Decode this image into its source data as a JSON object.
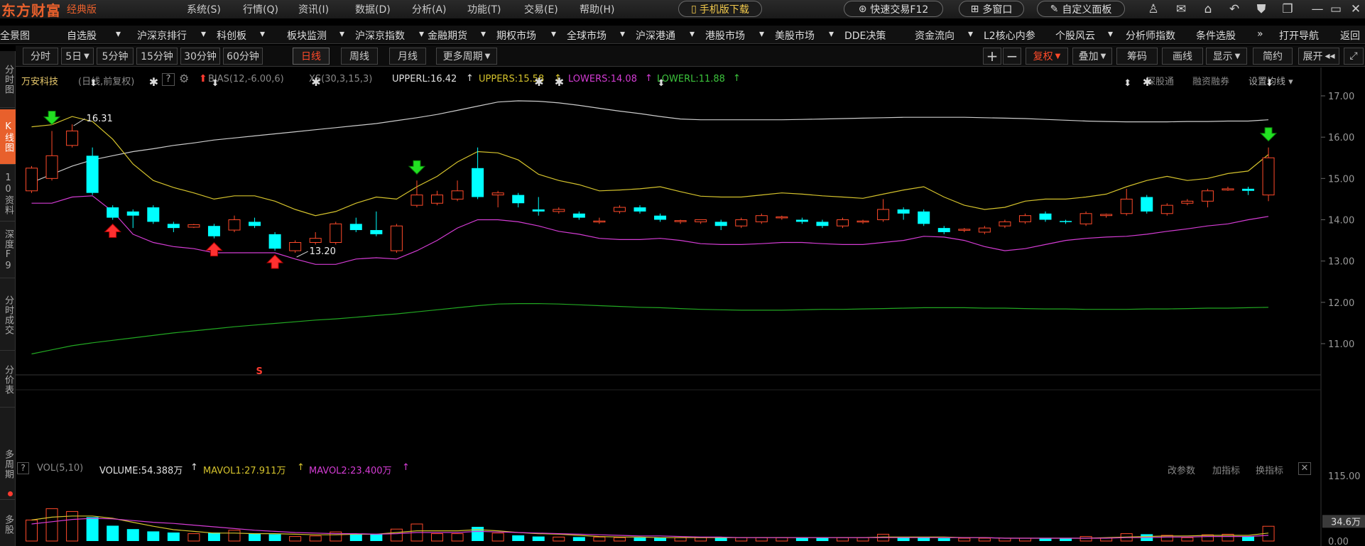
{
  "app": {
    "brand": "东方财富",
    "edition": "经典版"
  },
  "menu": [
    "系统(S)",
    "行情(Q)",
    "资讯(I)",
    "数据(D)",
    "分析(A)",
    "功能(T)",
    "交易(E)",
    "帮助(H)"
  ],
  "toolbar": {
    "mobile_download": "手机版下载",
    "fast_trade": "快速交易F12",
    "multi_window": "多窗口",
    "custom_panel": "自定义面板"
  },
  "nav": [
    "全景图",
    "自选股",
    "沪深京排行",
    "科创板",
    "板块监测",
    "沪深京指数",
    "金融期货",
    "期权市场",
    "全球市场",
    "沪深港通",
    "港股市场",
    "美股市场",
    "DDE决策",
    "资金流向",
    "L2核心内参",
    "个股风云",
    "分析师指数",
    "条件选股",
    "打开导航",
    "返回"
  ],
  "left_tabs": [
    "分时图",
    "K线图",
    "10资料",
    "深度F9",
    "分时成交",
    "分价表",
    "多周期",
    "多股"
  ],
  "periods": [
    "分时",
    "5日",
    "5分钟",
    "15分钟",
    "30分钟",
    "60分钟",
    "日线",
    "周线",
    "月线",
    "更多周期"
  ],
  "active_period": "日线",
  "right_tools": {
    "fuquan": "复权",
    "diejia": "叠加",
    "chouma": "筹码",
    "huaxian": "画线",
    "xianshi": "显示",
    "jianjie": "简约",
    "zhankai": "展开"
  },
  "info_bar": {
    "stock_name": "万安科技",
    "mode": "(日线,前复权)",
    "help": "?",
    "bias": "BIAS(12,-6.00,6)",
    "xs": "XS(30,3,15,3)",
    "upperl": "UPPERL:16.42",
    "uppers": "UPPERS:15.58",
    "lowers": "LOWERS:14.08",
    "lowerl": "LOWERL:11.88",
    "shengutong": "深股通",
    "rongzi": "融资融券",
    "set_ma": "设置均线"
  },
  "vol_bar": {
    "help": "?",
    "name": "VOL(5,10)",
    "volume": "VOLUME:54.388万",
    "mavol1": "MAVOL1:27.911万",
    "mavol2": "MAVOL2:23.400万",
    "gaicanshu": "改参数",
    "jiazhibiao": "加指标",
    "huanzhibiao": "换指标"
  },
  "colors": {
    "up": "#ff4a2a",
    "down": "#00ffff",
    "upperl": "#cccccc",
    "uppers": "#d4c22c",
    "lowers": "#d43cd4",
    "lowerl": "#22a822",
    "accent": "#e8602c"
  },
  "chart_data": {
    "type": "candlestick",
    "price_axis": {
      "ticks": [
        "17.00",
        "16.00",
        "15.00",
        "14.00",
        "13.00",
        "12.00",
        "11.00"
      ],
      "min": 10.5,
      "max": 17.2
    },
    "vol_axis": {
      "ticks": [
        "115.00",
        "34.6万",
        "0.00"
      ],
      "max": 115
    },
    "annotations": {
      "high": "16.31",
      "low": "13.20",
      "s_marker": "S"
    },
    "candles": [
      [
        14.7,
        15.25,
        14.65,
        15.3
      ],
      [
        15.0,
        15.55,
        14.95,
        16.15
      ],
      [
        15.8,
        16.15,
        15.75,
        16.31
      ],
      [
        15.55,
        14.65,
        14.6,
        15.75
      ],
      [
        14.3,
        14.05,
        14.0,
        14.35
      ],
      [
        14.2,
        14.1,
        13.8,
        14.25
      ],
      [
        14.3,
        13.95,
        13.9,
        14.35
      ],
      [
        13.9,
        13.8,
        13.7,
        13.95
      ],
      [
        13.82,
        13.88,
        13.8,
        13.9
      ],
      [
        13.85,
        13.6,
        13.55,
        13.9
      ],
      [
        13.75,
        14.0,
        13.7,
        14.1
      ],
      [
        13.95,
        13.85,
        13.8,
        14.05
      ],
      [
        13.65,
        13.3,
        13.25,
        13.7
      ],
      [
        13.25,
        13.45,
        13.2,
        13.5
      ],
      [
        13.45,
        13.55,
        13.4,
        13.7
      ],
      [
        13.45,
        13.9,
        13.4,
        13.95
      ],
      [
        13.9,
        13.75,
        13.7,
        14.05
      ],
      [
        13.75,
        13.65,
        13.6,
        14.2
      ],
      [
        13.25,
        13.85,
        13.2,
        13.9
      ],
      [
        14.35,
        14.6,
        14.3,
        14.95
      ],
      [
        14.4,
        14.6,
        14.35,
        14.7
      ],
      [
        14.5,
        14.7,
        14.45,
        14.95
      ],
      [
        15.25,
        14.55,
        14.5,
        15.75
      ],
      [
        14.6,
        14.65,
        14.3,
        14.7
      ],
      [
        14.6,
        14.4,
        14.3,
        14.65
      ],
      [
        14.25,
        14.2,
        14.1,
        14.55
      ],
      [
        14.2,
        14.25,
        14.15,
        14.3
      ],
      [
        14.15,
        14.05,
        14.0,
        14.2
      ],
      [
        13.95,
        13.97,
        13.9,
        14.05
      ],
      [
        14.2,
        14.3,
        14.15,
        14.35
      ],
      [
        14.3,
        14.2,
        14.15,
        14.35
      ],
      [
        14.1,
        14.0,
        13.95,
        14.15
      ],
      [
        13.97,
        13.98,
        13.9,
        14.0
      ],
      [
        13.95,
        14.0,
        13.9,
        14.0
      ],
      [
        13.95,
        13.85,
        13.75,
        14.0
      ],
      [
        13.85,
        14.0,
        13.8,
        14.05
      ],
      [
        13.95,
        14.1,
        13.9,
        14.15
      ],
      [
        14.05,
        14.07,
        14.0,
        14.1
      ],
      [
        14.0,
        13.95,
        13.9,
        14.05
      ],
      [
        13.95,
        13.85,
        13.8,
        14.0
      ],
      [
        13.85,
        14.0,
        13.8,
        14.05
      ],
      [
        13.95,
        13.97,
        13.9,
        14.0
      ],
      [
        14.0,
        14.25,
        13.95,
        14.5
      ],
      [
        14.25,
        14.15,
        14.0,
        14.3
      ],
      [
        14.2,
        13.9,
        13.85,
        14.25
      ],
      [
        13.8,
        13.7,
        13.65,
        13.85
      ],
      [
        13.75,
        13.77,
        13.7,
        13.8
      ],
      [
        13.7,
        13.8,
        13.65,
        13.85
      ],
      [
        13.85,
        13.95,
        13.8,
        14.0
      ],
      [
        13.95,
        14.1,
        13.9,
        14.15
      ],
      [
        14.15,
        14.0,
        13.95,
        14.2
      ],
      [
        13.97,
        13.95,
        13.9,
        14.0
      ],
      [
        13.9,
        14.15,
        13.85,
        14.2
      ],
      [
        14.1,
        14.13,
        14.05,
        14.15
      ],
      [
        14.15,
        14.5,
        14.1,
        14.75
      ],
      [
        14.55,
        14.2,
        14.15,
        14.6
      ],
      [
        14.15,
        14.35,
        14.1,
        14.4
      ],
      [
        14.4,
        14.45,
        14.35,
        14.5
      ],
      [
        14.45,
        14.7,
        14.3,
        14.75
      ],
      [
        14.72,
        14.75,
        14.7,
        14.8
      ],
      [
        14.75,
        14.7,
        14.6,
        14.8
      ],
      [
        14.6,
        15.5,
        14.45,
        15.75
      ]
    ],
    "volumes": [
      37,
      57,
      52,
      42,
      27,
      21,
      17,
      15,
      13,
      15,
      19,
      13,
      12,
      8,
      9,
      16,
      13,
      12,
      21,
      30,
      13,
      13,
      25,
      14,
      10,
      8,
      7,
      7,
      7,
      6,
      6,
      6,
      6,
      6,
      6,
      6,
      6,
      6,
      6,
      6,
      6,
      6,
      12,
      6,
      6,
      5,
      5,
      5,
      5,
      5,
      5,
      5,
      8,
      5,
      13,
      12,
      10,
      6,
      11,
      12,
      8,
      26
    ],
    "series": {
      "upperl": [
        14.9,
        15.1,
        15.3,
        15.45,
        15.55,
        15.65,
        15.72,
        15.8,
        15.86,
        15.93,
        15.98,
        16.03,
        16.08,
        16.13,
        16.18,
        16.23,
        16.28,
        16.33,
        16.4,
        16.47,
        16.55,
        16.65,
        16.75,
        16.85,
        16.88,
        16.87,
        16.83,
        16.77,
        16.7,
        16.63,
        16.57,
        16.5,
        16.44,
        16.42,
        16.42,
        16.42,
        16.42,
        16.42,
        16.43,
        16.44,
        16.45,
        16.46,
        16.47,
        16.48,
        16.48,
        16.48,
        16.48,
        16.47,
        16.46,
        16.45,
        16.43,
        16.41,
        16.39,
        16.38,
        16.37,
        16.37,
        16.37,
        16.38,
        16.38,
        16.39,
        16.39,
        16.42
      ],
      "uppers": [
        16.25,
        16.3,
        16.5,
        16.38,
        15.95,
        15.35,
        14.95,
        14.78,
        14.65,
        14.5,
        14.58,
        14.58,
        14.45,
        14.25,
        14.1,
        14.2,
        14.4,
        14.55,
        14.5,
        14.8,
        15.05,
        15.4,
        15.65,
        15.62,
        15.45,
        15.1,
        14.95,
        14.85,
        14.7,
        14.72,
        14.75,
        14.8,
        14.68,
        14.57,
        14.55,
        14.55,
        14.6,
        14.65,
        14.62,
        14.58,
        14.55,
        14.52,
        14.62,
        14.72,
        14.8,
        14.55,
        14.35,
        14.25,
        14.3,
        14.45,
        14.5,
        14.5,
        14.55,
        14.62,
        14.8,
        14.95,
        15.05,
        14.95,
        15.0,
        15.12,
        15.18,
        15.58
      ],
      "lowers": [
        14.4,
        14.4,
        14.55,
        14.58,
        14.2,
        13.65,
        13.45,
        13.35,
        13.3,
        13.2,
        13.2,
        13.2,
        13.2,
        13.05,
        12.92,
        12.92,
        13.05,
        13.08,
        13.05,
        13.25,
        13.5,
        13.8,
        14.0,
        14.0,
        13.95,
        13.85,
        13.72,
        13.65,
        13.55,
        13.52,
        13.52,
        13.55,
        13.5,
        13.42,
        13.4,
        13.4,
        13.42,
        13.45,
        13.45,
        13.42,
        13.4,
        13.4,
        13.45,
        13.5,
        13.6,
        13.58,
        13.5,
        13.35,
        13.25,
        13.3,
        13.4,
        13.5,
        13.55,
        13.58,
        13.6,
        13.65,
        13.72,
        13.78,
        13.85,
        13.9,
        14.0,
        14.08
      ],
      "lowerl": [
        10.75,
        10.85,
        10.95,
        11.02,
        11.08,
        11.14,
        11.2,
        11.26,
        11.31,
        11.36,
        11.41,
        11.45,
        11.49,
        11.53,
        11.57,
        11.6,
        11.64,
        11.68,
        11.72,
        11.77,
        11.82,
        11.87,
        11.92,
        11.96,
        11.97,
        11.97,
        11.96,
        11.94,
        11.92,
        11.9,
        11.88,
        11.87,
        11.85,
        11.83,
        11.82,
        11.81,
        11.81,
        11.81,
        11.82,
        11.83,
        11.83,
        11.84,
        11.85,
        11.86,
        11.87,
        11.87,
        11.87,
        11.86,
        11.86,
        11.85,
        11.84,
        11.84,
        11.83,
        11.83,
        11.83,
        11.84,
        11.84,
        11.85,
        11.86,
        11.86,
        11.87,
        11.88
      ],
      "mavol1": [
        37,
        42,
        44,
        44,
        40,
        33,
        26,
        20,
        17,
        14,
        14,
        13,
        13,
        12,
        11,
        11,
        12,
        12,
        15,
        18,
        18,
        18,
        20,
        18,
        15,
        13,
        12,
        10,
        8,
        7,
        7,
        6,
        6,
        6,
        6,
        6,
        6,
        6,
        6,
        6,
        6,
        6,
        7,
        7,
        7,
        7,
        6,
        6,
        5,
        5,
        5,
        5,
        5,
        6,
        7,
        8,
        9,
        9,
        10,
        10,
        10,
        14
      ],
      "mavol2": [
        30,
        34,
        38,
        40,
        39,
        36,
        33,
        31,
        28,
        25,
        22,
        19,
        17,
        15,
        14,
        13,
        13,
        12,
        13,
        15,
        15,
        15,
        17,
        16,
        15,
        14,
        13,
        12,
        11,
        10,
        9,
        9,
        8,
        7,
        7,
        6,
        6,
        6,
        6,
        6,
        6,
        6,
        6,
        6,
        6,
        6,
        6,
        6,
        5,
        5,
        5,
        5,
        5,
        5,
        6,
        6,
        7,
        7,
        8,
        8,
        8,
        10
      ]
    },
    "markers": {
      "green_down": [
        1,
        19,
        61
      ],
      "red_up": [
        4,
        9,
        12
      ],
      "top_asterisk": [
        6,
        14,
        25,
        26,
        55
      ],
      "top_arrows": [
        3,
        9,
        31,
        54,
        61
      ]
    }
  }
}
